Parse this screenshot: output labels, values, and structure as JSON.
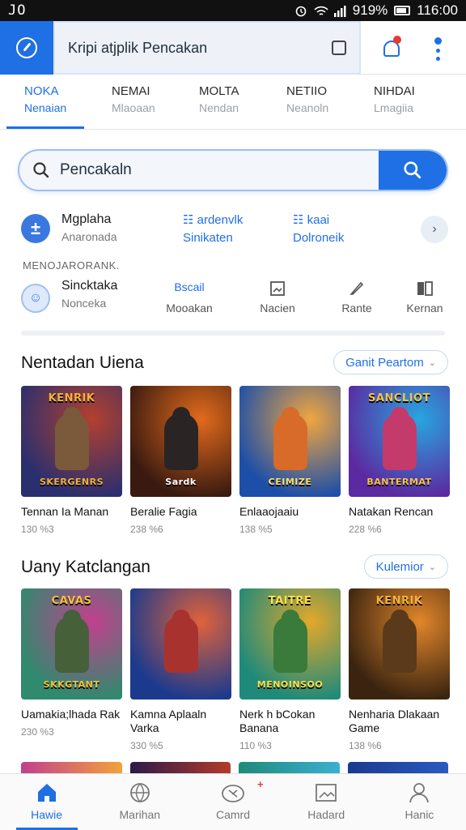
{
  "status_bar": {
    "left": "JO",
    "right": "919%",
    "time": "116:00"
  },
  "header": {
    "url_text": "Kripi atjplik Pencakan"
  },
  "tabs": [
    {
      "title": "NOKA",
      "subtitle": "Nenaian",
      "active": true
    },
    {
      "title": "NEMAI",
      "subtitle": "Mlaoaan",
      "active": false
    },
    {
      "title": "MOLTA",
      "subtitle": "Nendan",
      "active": false
    },
    {
      "title": "NETIIO",
      "subtitle": "Neanoln",
      "active": false
    },
    {
      "title": "NIHDAI",
      "subtitle": "Lmagiia",
      "active": false
    }
  ],
  "search": {
    "value": "Pencakaln"
  },
  "quick": {
    "avatar_letter": "±",
    "name": "Mgplaha",
    "subtitle": "Anaronada",
    "link1": {
      "icon": "list-icon",
      "label": "ardenvlk",
      "sub": "Sinikaten"
    },
    "link2": {
      "icon": "list-icon",
      "label": "kaai",
      "sub": "Dolroneik"
    }
  },
  "section_caption": "MENOJARORANK.",
  "tools": {
    "main": {
      "name": "Sincktaka",
      "sub": "Nonceka"
    },
    "items": [
      {
        "icon": "Bscail",
        "label": "Mooakan"
      },
      {
        "icon": "image-icon",
        "label": "Nacien"
      },
      {
        "icon": "pen-icon",
        "label": "Rante"
      },
      {
        "icon": "book-icon",
        "label": "Kernan"
      }
    ]
  },
  "section1": {
    "title": "Nentadan Uiena",
    "pill": "Ganit Peartom",
    "games": [
      {
        "thumb_title": "KENRIK",
        "thumb_sub": "SKERGENRS",
        "name": "Tennan Ia Manan",
        "meta": "130 %3",
        "bg1": "#2a2f6e",
        "bg2": "#b4402e",
        "fig": "#7a5a3a",
        "text_color": "#f2b23a"
      },
      {
        "thumb_title": "",
        "thumb_sub": "Sardk",
        "name": "Beralie Fagia",
        "meta": "238 %6",
        "bg1": "#3a1a10",
        "bg2": "#e26a1c",
        "fig": "#2b2424",
        "text_color": "#ffffff"
      },
      {
        "thumb_title": "",
        "thumb_sub": "CEIMIZE",
        "name": "Enlaaojaaiu",
        "meta": "138 %5",
        "bg1": "#1d4fa8",
        "bg2": "#f0a640",
        "fig": "#d86a2a",
        "text_color": "#ffe26a"
      },
      {
        "thumb_title": "SANCLIOT",
        "thumb_sub": "BANTERMAT",
        "name": "Natakan Rencan",
        "meta": "228 %6",
        "bg1": "#5b2aa0",
        "bg2": "#27a6e0",
        "fig": "#c43a6a",
        "text_color": "#f6c34a"
      }
    ]
  },
  "section2": {
    "title": "Uany Katclangan",
    "pill": "Kulemior",
    "games": [
      {
        "thumb_title": "CAVAS",
        "thumb_sub": "SKKGTANT",
        "name": "Uamakia;lhada Rak",
        "meta": "230 %3",
        "bg1": "#2f8a6e",
        "bg2": "#c2408e",
        "fig": "#46603a",
        "text_color": "#f2c23a"
      },
      {
        "thumb_title": "",
        "thumb_sub": "",
        "name": "Kamna Aplaaln Varka",
        "meta": "330 %5",
        "bg1": "#1b3a8e",
        "bg2": "#e0623a",
        "fig": "#a8322e",
        "text_color": "#ffd54a"
      },
      {
        "thumb_title": "TAITRE",
        "thumb_sub": "MENOINSOO",
        "name": "Nerk h bCokan Banana",
        "meta": "110 %3",
        "bg1": "#1f8a7a",
        "bg2": "#e4a82a",
        "fig": "#3a7a3a",
        "text_color": "#ffe04a"
      },
      {
        "thumb_title": "KENRIK",
        "thumb_sub": "",
        "name": "Nenharia Dlakaan Game",
        "meta": "138 %6",
        "bg1": "#3a2410",
        "bg2": "#e2862a",
        "fig": "#5a3a1a",
        "text_color": "#f6b23a"
      }
    ]
  },
  "bottom_nav": [
    {
      "icon": "home-icon",
      "label": "Hawie",
      "active": true
    },
    {
      "icon": "globe-icon",
      "label": "Marihan",
      "active": false
    },
    {
      "icon": "gamepad-icon",
      "label": "Camrd",
      "active": false
    },
    {
      "icon": "image-icon",
      "label": "Hadard",
      "active": false
    },
    {
      "icon": "user-icon",
      "label": "Hanic",
      "active": false
    }
  ],
  "colors": {
    "accent": "#1f6fe5",
    "alert": "#e53935"
  }
}
